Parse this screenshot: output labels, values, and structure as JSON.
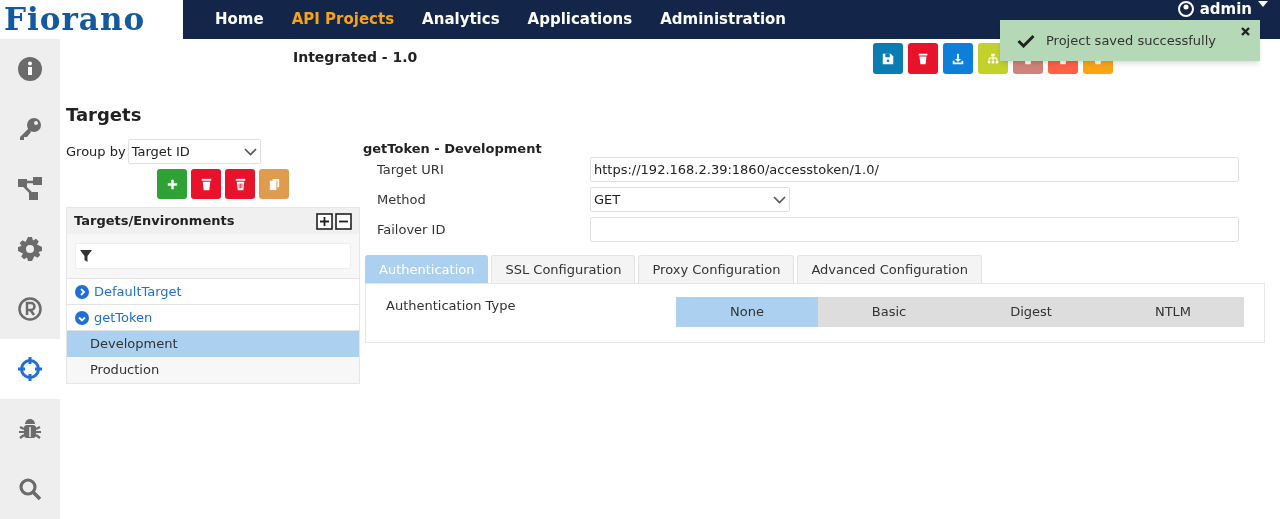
{
  "brand": {
    "logo": "Fiorano"
  },
  "nav": [
    {
      "label": "Home",
      "selected": false
    },
    {
      "label": "API Projects",
      "selected": true
    },
    {
      "label": "Analytics",
      "selected": false
    },
    {
      "label": "Applications",
      "selected": false
    },
    {
      "label": "Administration",
      "selected": false
    }
  ],
  "user": {
    "name": "admin"
  },
  "sidebar": [
    {
      "kind": "info",
      "selected": false
    },
    {
      "kind": "key",
      "selected": false
    },
    {
      "kind": "flow",
      "selected": false
    },
    {
      "kind": "gear",
      "selected": false
    },
    {
      "kind": "registered",
      "selected": false
    },
    {
      "kind": "crosshair",
      "selected": true
    },
    {
      "kind": "bug",
      "selected": false
    },
    {
      "kind": "search",
      "selected": false
    }
  ],
  "project": {
    "title": "Integrated - 1.0"
  },
  "toolbar": [
    {
      "kind": "save",
      "color": "#0a7cb3"
    },
    {
      "kind": "trash",
      "color": "#e8122a"
    },
    {
      "kind": "download",
      "color": "#0d7fd8"
    },
    {
      "kind": "sitemap",
      "color": "#c3d12c"
    },
    {
      "kind": "trash",
      "color": "#d0837a"
    },
    {
      "kind": "trash",
      "color": "#fd6248"
    },
    {
      "kind": "trash",
      "color": "#fba516"
    }
  ],
  "toast": {
    "message": "Project saved successfully"
  },
  "targets": {
    "title": "Targets",
    "group_by": {
      "label": "Group by",
      "value": "Target ID"
    },
    "actions": [
      {
        "kind": "plus",
        "color": "#2ea334"
      },
      {
        "kind": "trash",
        "color": "#e8122a"
      },
      {
        "kind": "trash-all",
        "color": "#e8122a"
      },
      {
        "kind": "copy",
        "color": "#df9c4f"
      }
    ],
    "tree": {
      "title": "Targets/Environments",
      "items": [
        {
          "label": "DefaultTarget",
          "expanded": false,
          "selected": false
        },
        {
          "label": "getToken",
          "expanded": true,
          "selected": false,
          "children": [
            {
              "label": "Development",
              "selected": true
            },
            {
              "label": "Production",
              "selected": false
            }
          ]
        }
      ]
    }
  },
  "detail": {
    "heading": "getToken - Development",
    "fields": [
      {
        "label": "Target URI",
        "kind": "text",
        "value": "https://192.168.2.39:1860/accesstoken/1.0/"
      },
      {
        "label": "Method",
        "kind": "select",
        "value": "GET"
      },
      {
        "label": "Failover ID",
        "kind": "text"
      }
    ],
    "tabs": [
      {
        "label": "Authentication",
        "selected": true
      },
      {
        "label": "SSL Configuration",
        "selected": false
      },
      {
        "label": "Proxy Configuration",
        "selected": false
      },
      {
        "label": "Advanced Configuration",
        "selected": false
      }
    ],
    "auth": {
      "label": "Authentication Type",
      "options": [
        {
          "label": "None",
          "selected": true
        },
        {
          "label": "Basic",
          "selected": false
        },
        {
          "label": "Digest",
          "selected": false
        },
        {
          "label": "NTLM",
          "selected": false
        }
      ]
    }
  }
}
